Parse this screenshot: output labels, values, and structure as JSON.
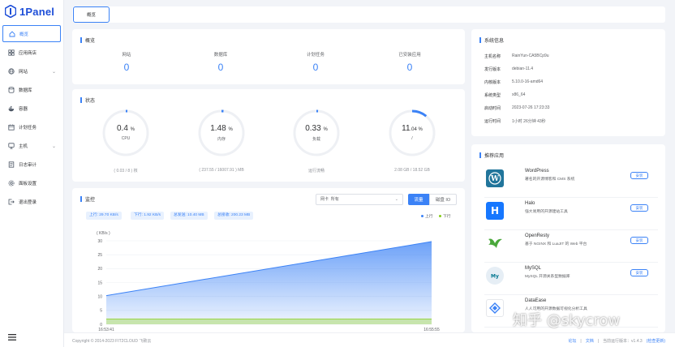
{
  "brand": {
    "name": "1Panel",
    "color": "#1d4ed8"
  },
  "sidebar": {
    "items": [
      {
        "label": "概览",
        "icon": "home-icon",
        "active": true
      },
      {
        "label": "应用商店",
        "icon": "app-store-icon"
      },
      {
        "label": "网站",
        "icon": "globe-icon",
        "chevron": true
      },
      {
        "label": "数据库",
        "icon": "database-icon"
      },
      {
        "label": "容器",
        "icon": "docker-icon"
      },
      {
        "label": "计划任务",
        "icon": "calendar-icon"
      },
      {
        "label": "主机",
        "icon": "host-icon",
        "chevron": true
      },
      {
        "label": "日志审计",
        "icon": "log-icon"
      },
      {
        "label": "面板设置",
        "icon": "settings-icon"
      },
      {
        "label": "退出登录",
        "icon": "logout-icon"
      }
    ]
  },
  "tabs": [
    {
      "label": "概览"
    }
  ],
  "overview": {
    "title": "概览",
    "items": [
      {
        "label": "网站",
        "value": "0"
      },
      {
        "label": "数据库",
        "value": "0"
      },
      {
        "label": "计划任务",
        "value": "0"
      },
      {
        "label": "已安装应用",
        "value": "0"
      }
    ]
  },
  "status": {
    "title": "状态",
    "gauges": [
      {
        "value": "0.4",
        "unit": "%",
        "label": "CPU",
        "fraction": 0.004,
        "foot": "( 0.03 / 8 ) 核"
      },
      {
        "value": "1.48",
        "unit": "%",
        "label": "内存",
        "fraction": 0.0148,
        "foot": "( 237.55 / 16007.91 ) MB"
      },
      {
        "value": "0.33",
        "unit": "%",
        "label": "负载",
        "fraction": 0.0033,
        "foot": "运行流畅"
      },
      {
        "value": "11",
        "unit": ".04 %",
        "label": "/",
        "fraction": 0.1104,
        "foot": "2.08 GB / 18.52 GB"
      }
    ]
  },
  "monitor": {
    "title": "监控",
    "select_label": "网卡",
    "select_value": "所有",
    "seg_on": "流量",
    "seg_off": "磁盘 IO",
    "chips": [
      "上行: 29.70 KB/s",
      "下行: 1.92 KB/s",
      "总发送: 10.40 MB",
      "总接收: 200.23 MB"
    ],
    "legend_up": "上行",
    "legend_down": "下行",
    "accent": "#3b82f6",
    "secondary": "#84cc16"
  },
  "chart_data": {
    "type": "area",
    "ylabel": "( KB/s )",
    "ylim": [
      0,
      30
    ],
    "yticks": [
      "30",
      "25",
      "20",
      "15",
      "10",
      "5",
      "0"
    ],
    "xticks": [
      "16:53:41",
      "16:55:55"
    ],
    "series": [
      {
        "name": "上行",
        "start": 10.3,
        "end": 29.7,
        "color": "#3b82f6"
      },
      {
        "name": "下行",
        "start": 1.9,
        "end": 1.9,
        "color": "#84cc16"
      }
    ]
  },
  "sysinfo": {
    "title": "系统信息",
    "rows": [
      {
        "k": "主机名称",
        "v": "RainYun-CA5BCp9u"
      },
      {
        "k": "发行版本",
        "v": "debian-11.4"
      },
      {
        "k": "内核版本",
        "v": "5.10.0-16-amd64"
      },
      {
        "k": "系统类型",
        "v": "x86_64"
      },
      {
        "k": "启动时间",
        "v": "2023-07-26 17:23:33"
      },
      {
        "k": "运行时间",
        "v": "1小时 26分钟 43秒"
      }
    ]
  },
  "apps": {
    "title": "推荐应用",
    "install_label": "安装",
    "items": [
      {
        "name": "WordPress",
        "desc": "著名的开源博客和 CMS 系统",
        "icon": "wordpress-icon"
      },
      {
        "name": "Halo",
        "desc": "强大易用的开源建站工具",
        "icon": "halo-icon"
      },
      {
        "name": "OpenResty",
        "desc": "基于 NGINX 和 LuaJIT 的 Web 平台",
        "icon": "openresty-icon"
      },
      {
        "name": "MySQL",
        "desc": "MySQL 开源关系型数据库",
        "icon": "mysql-icon"
      },
      {
        "name": "DataEase",
        "desc": "人人可用的开源数据可视化分析工具",
        "icon": "dataease-icon"
      }
    ]
  },
  "footer": {
    "copyright": "Copyright © 2014-2023 FIT2CLOUD 飞致云",
    "forum": "论坛",
    "docs": "文档",
    "version_label": "当前运行版本：v1.4.3",
    "check_update": "(检查更新)"
  },
  "watermark": "知乎 @skycrow"
}
